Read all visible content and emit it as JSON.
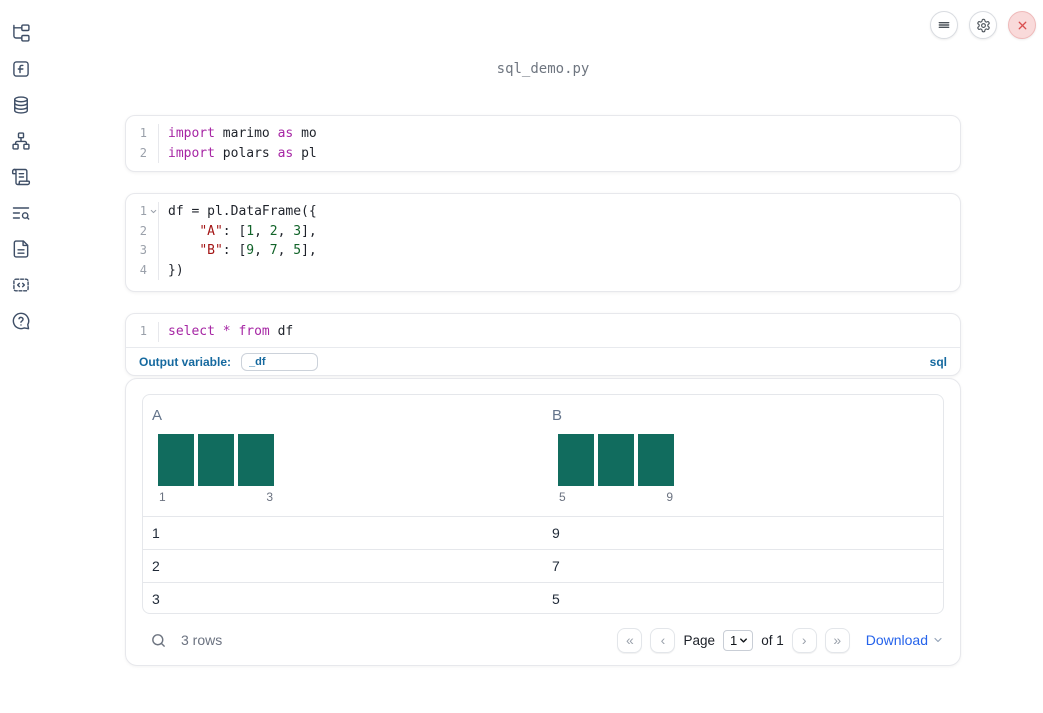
{
  "window_title": "sql_demo.py",
  "topbar": {
    "icons": [
      "menu-icon",
      "settings-icon",
      "close-icon"
    ]
  },
  "sidebar": {
    "icons": [
      "file-explorer-icon",
      "variables-icon",
      "datasources-icon",
      "dependencies-icon",
      "logs-icon",
      "text-search-icon",
      "documentation-icon",
      "snippets-icon",
      "help-icon"
    ]
  },
  "cells": [
    {
      "name": "imports-cell",
      "lines": [
        {
          "num": "1",
          "tokens": [
            {
              "text": "import"
            },
            {
              "text": " marimo "
            },
            {
              "text": "as"
            },
            {
              "text": " mo"
            }
          ]
        },
        {
          "num": "2",
          "tokens": [
            {
              "text": "import"
            },
            {
              "text": " polars "
            },
            {
              "text": "as"
            },
            {
              "text": " pl"
            }
          ]
        }
      ]
    },
    {
      "name": "dataframe-cell",
      "lines": [
        {
          "num": "1",
          "tokens": [
            {
              "text": "df = pl.DataFrame({"
            }
          ]
        },
        {
          "num": "2",
          "tokens": [
            {
              "text": "    "
            },
            {
              "text": "\"A\""
            },
            {
              "text": ": ["
            },
            {
              "text": "1"
            },
            {
              "text": ", "
            },
            {
              "text": "2"
            },
            {
              "text": ", "
            },
            {
              "text": "3"
            },
            {
              "text": "],"
            }
          ]
        },
        {
          "num": "3",
          "tokens": [
            {
              "text": "    "
            },
            {
              "text": "\"B\""
            },
            {
              "text": ": ["
            },
            {
              "text": "9"
            },
            {
              "text": ", "
            },
            {
              "text": "7"
            },
            {
              "text": ", "
            },
            {
              "text": "5"
            },
            {
              "text": "],"
            }
          ]
        },
        {
          "num": "4",
          "tokens": [
            {
              "text": "})"
            }
          ]
        }
      ]
    },
    {
      "name": "sql-cell",
      "lines": [
        {
          "num": "1",
          "tokens": [
            {
              "text": "select"
            },
            {
              "text": " "
            },
            {
              "text": "*"
            },
            {
              "text": " "
            },
            {
              "text": "from"
            },
            {
              "text": " df"
            }
          ]
        }
      ],
      "footer": {
        "output_variable_label": "Output variable:",
        "output_variable_value": "_df",
        "language": "sql"
      }
    }
  ],
  "table": {
    "columns": [
      {
        "header": "A",
        "hist": {
          "bar_count": 3,
          "bar_color": "#116c5e",
          "min_label": "1",
          "max_label": "3"
        }
      },
      {
        "header": "B",
        "hist": {
          "bar_count": 3,
          "bar_color": "#116c5e",
          "min_label": "5",
          "max_label": "9"
        }
      }
    ],
    "rows": [
      [
        "1",
        "9"
      ],
      [
        "2",
        "7"
      ],
      [
        "3",
        "5"
      ]
    ],
    "footer": {
      "row_count": "3 rows",
      "page_label": "Page",
      "page_value": "1",
      "page_of": "of 1",
      "download_label": "Download"
    }
  },
  "icons": {
    "first_page": "«",
    "prev_page": "‹",
    "next_page": "›",
    "last_page": "»"
  },
  "colors": {
    "accent_blue": "#15699f",
    "link_blue": "#2563eb",
    "bar_teal": "#116c5e",
    "keyword": "#a626a4",
    "string": "#a31515",
    "number": "#116329"
  }
}
